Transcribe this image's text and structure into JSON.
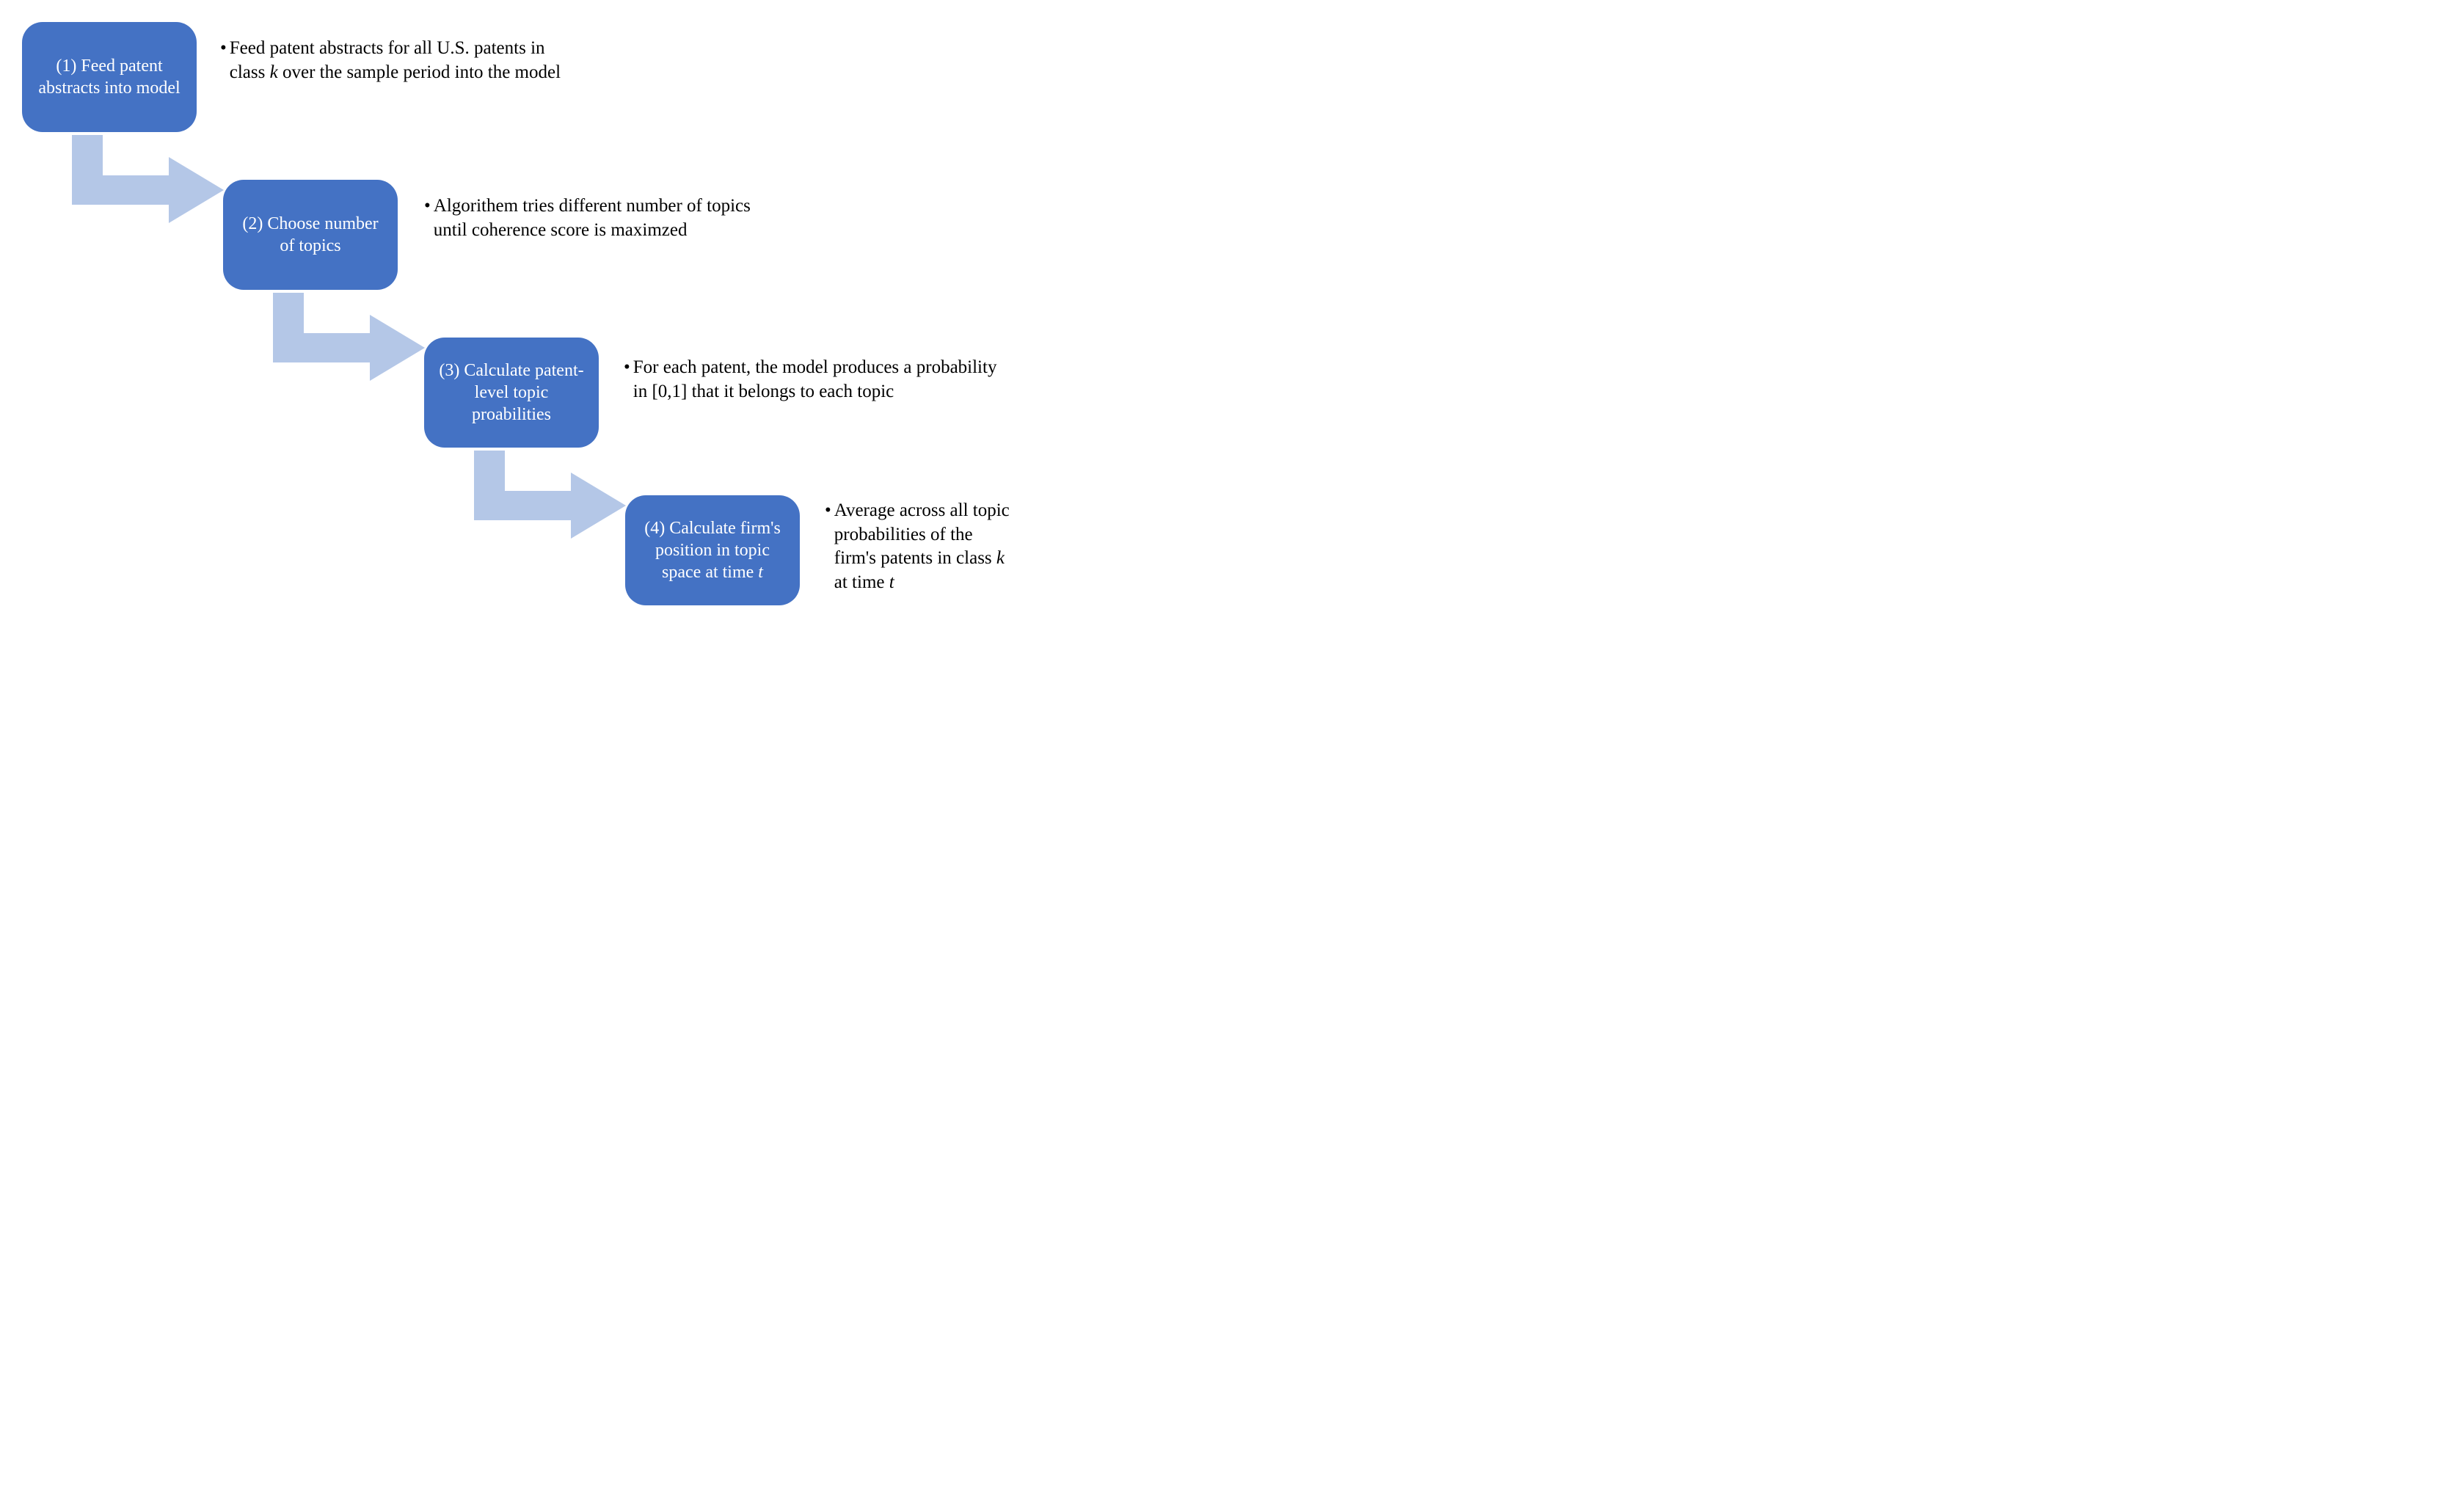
{
  "steps": [
    {
      "box_label": "(1) Feed patent abstracts into model",
      "desc_prefix": "Feed patent abstracts for all U.S. patents in class ",
      "desc_var1": "k",
      "desc_suffix": " over the sample period into the model"
    },
    {
      "box_label": "(2) Choose number of topics",
      "desc_full": "Algorithem tries different number of topics until coherence score is maximzed"
    },
    {
      "box_label": "(3) Calculate patent-level topic proabilities",
      "desc_full": "For each patent, the model produces a probability in [0,1] that it belongs to each topic"
    },
    {
      "box_label": "(4) Calculate firm's position in topic space at time ",
      "box_var": "t",
      "desc_prefix": "Average across all topic probabilities of the firm's patents in class ",
      "desc_var1": "k",
      "desc_mid": " at time ",
      "desc_var2": "t"
    }
  ],
  "colors": {
    "box_fill": "#4472c4",
    "arrow_fill": "#b4c7e7"
  }
}
